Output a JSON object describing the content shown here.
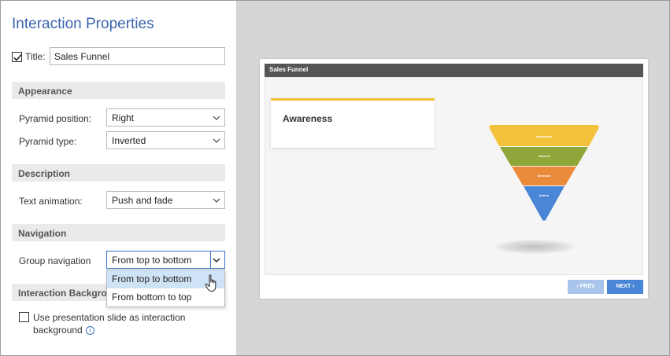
{
  "panel": {
    "title": "Interaction Properties",
    "title_checkbox_label": "Title:",
    "title_checked": true,
    "title_value": "Sales Funnel"
  },
  "sections": {
    "appearance": "Appearance",
    "description": "Description",
    "navigation": "Navigation",
    "interaction_background": "Interaction Background"
  },
  "appearance": {
    "pyramid_position_label": "Pyramid position:",
    "pyramid_position_value": "Right",
    "pyramid_type_label": "Pyramid type:",
    "pyramid_type_value": "Inverted"
  },
  "description": {
    "text_animation_label": "Text animation:",
    "text_animation_value": "Push and fade"
  },
  "navigation": {
    "group_navigation_label": "Group navigation",
    "group_navigation_value": "From top to bottom",
    "options": [
      "From top to bottom",
      "From bottom to top"
    ],
    "hovered_option": "From top to bottom"
  },
  "background": {
    "checkbox_checked": false,
    "label": "Use presentation slide as interaction background"
  },
  "preview": {
    "header": "Sales Funnel",
    "card_title": "Awareness",
    "funnel_levels": [
      {
        "label": "Awareness",
        "color": "#f2c23a"
      },
      {
        "label": "Interest",
        "color": "#8fa63a"
      },
      {
        "label": "Decision",
        "color": "#ec8a3c"
      },
      {
        "label": "Action",
        "color": "#4a86d6"
      }
    ],
    "prev_label": "‹ PREV",
    "next_label": "NEXT ›"
  },
  "colors": {
    "accent": "#3b63b0",
    "selection": "#cfe3f7",
    "preview_bg": "#d4d6d8"
  }
}
